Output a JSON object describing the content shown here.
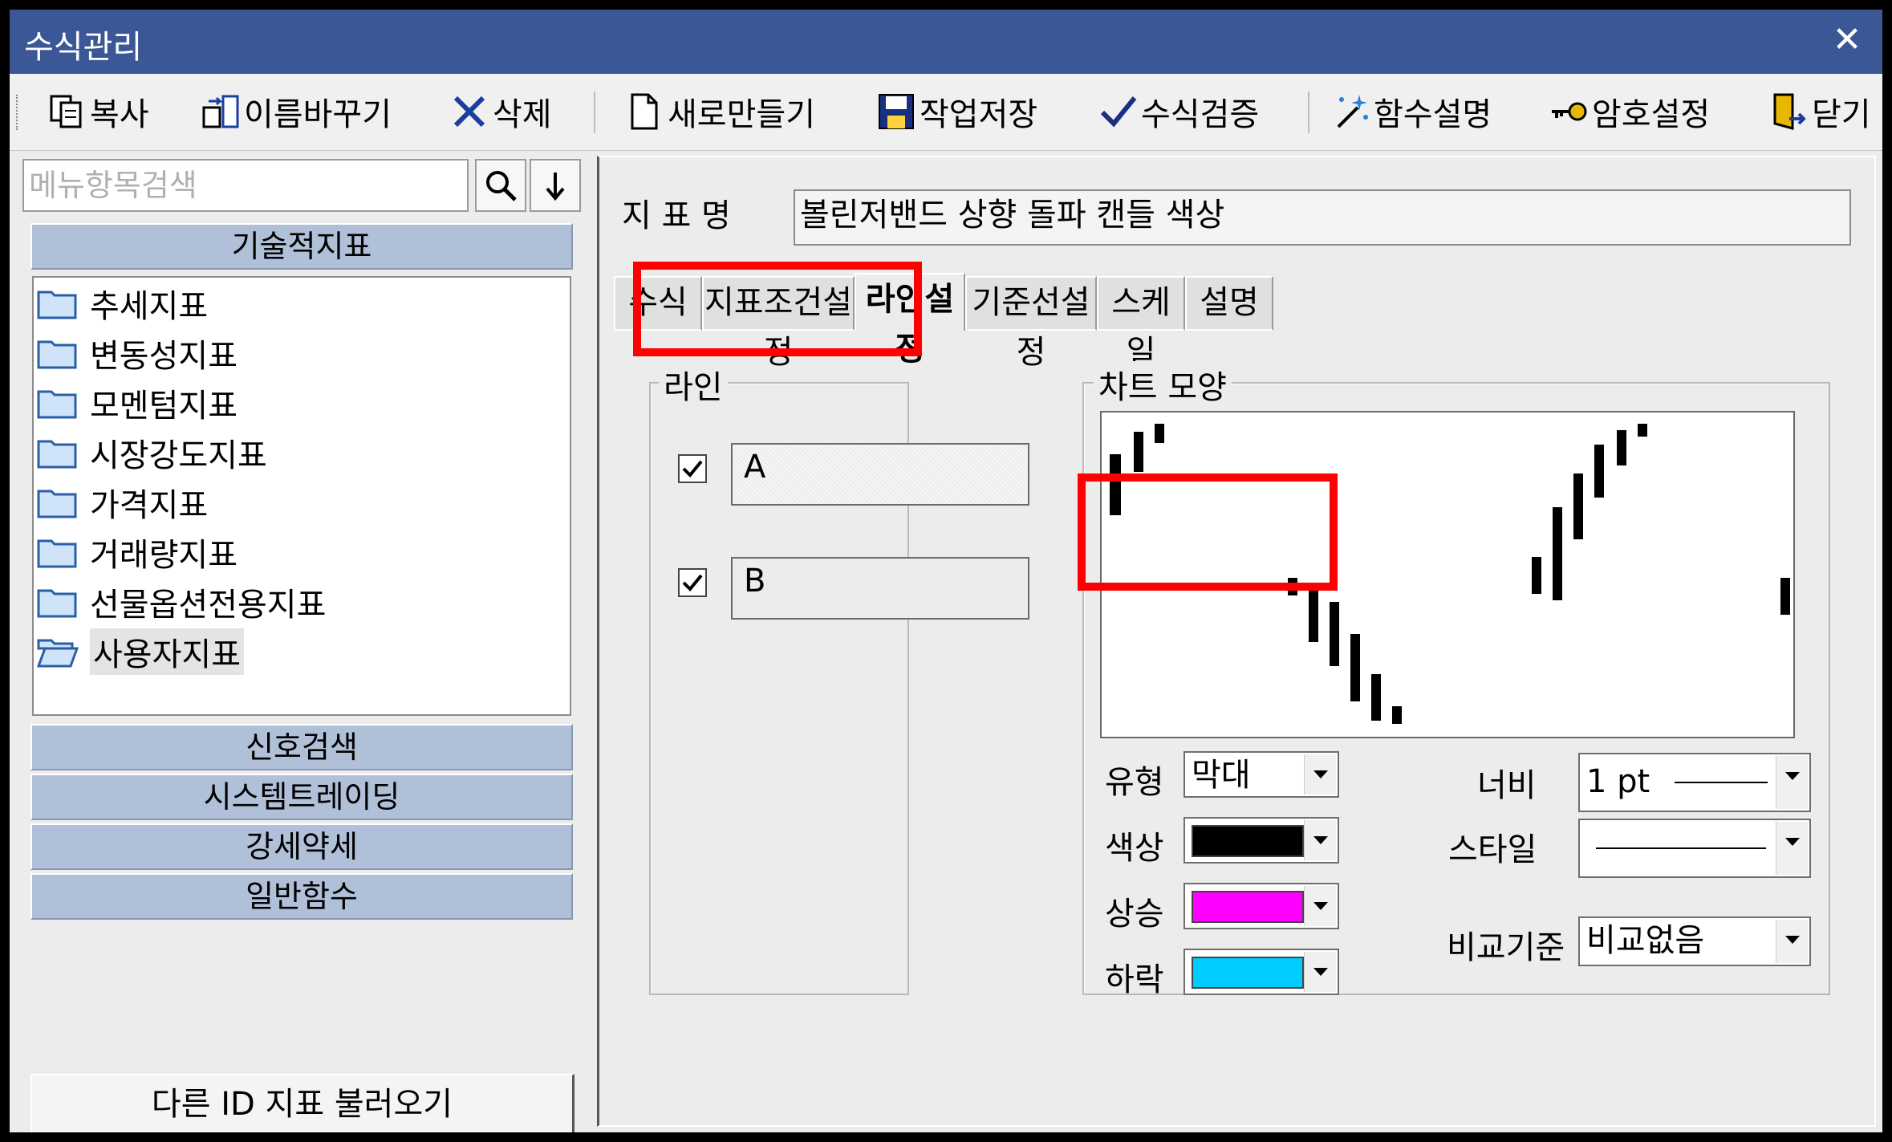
{
  "window": {
    "title": "수식관리",
    "close_glyph": "✕"
  },
  "toolbar": {
    "copy": "복사",
    "rename": "이름바꾸기",
    "delete": "삭제",
    "new": "새로만들기",
    "save": "작업저장",
    "verify": "수식검증",
    "func_help": "함수설명",
    "password": "암호설정",
    "close": "닫기"
  },
  "left": {
    "search_placeholder": "메뉴항목검색",
    "category_main": "기술적지표",
    "tree_items": [
      "추세지표",
      "변동성지표",
      "모멘텀지표",
      "시장강도지표",
      "가격지표",
      "거래량지표",
      "선물옵션전용지표",
      "사용자지표"
    ],
    "categories": [
      "신호검색",
      "시스템트레이딩",
      "강세약세",
      "일반함수"
    ],
    "load_button": "다른 ID 지표 불러오기"
  },
  "right": {
    "name_label": "지 표 명",
    "name_value": "볼린저밴드 상향 돌파 캔들 색상",
    "tabs": [
      "수식",
      "지표조건설정",
      "라인설정",
      "기준선설정",
      "스케일",
      "설명"
    ],
    "active_tab": "라인설정",
    "line_group": {
      "label": "라인",
      "lines": [
        {
          "name": "A",
          "checked": true
        },
        {
          "name": "B",
          "checked": true
        }
      ]
    },
    "shape_group": {
      "label": "차트 모양",
      "type_label": "유형",
      "type_value": "막대",
      "color_label": "색상",
      "color_value": "#000000",
      "up_label": "상승",
      "up_value": "#ff00ff",
      "down_label": "하락",
      "down_value": "#00ccff",
      "width_label": "너비",
      "width_value": "1 pt",
      "style_label": "스타일",
      "compare_label": "비교기준",
      "compare_value": "비교없음"
    }
  },
  "colors": {
    "titlebar": "#3b5796",
    "category": "#b0c0d8",
    "highlight": "#ff0000"
  }
}
